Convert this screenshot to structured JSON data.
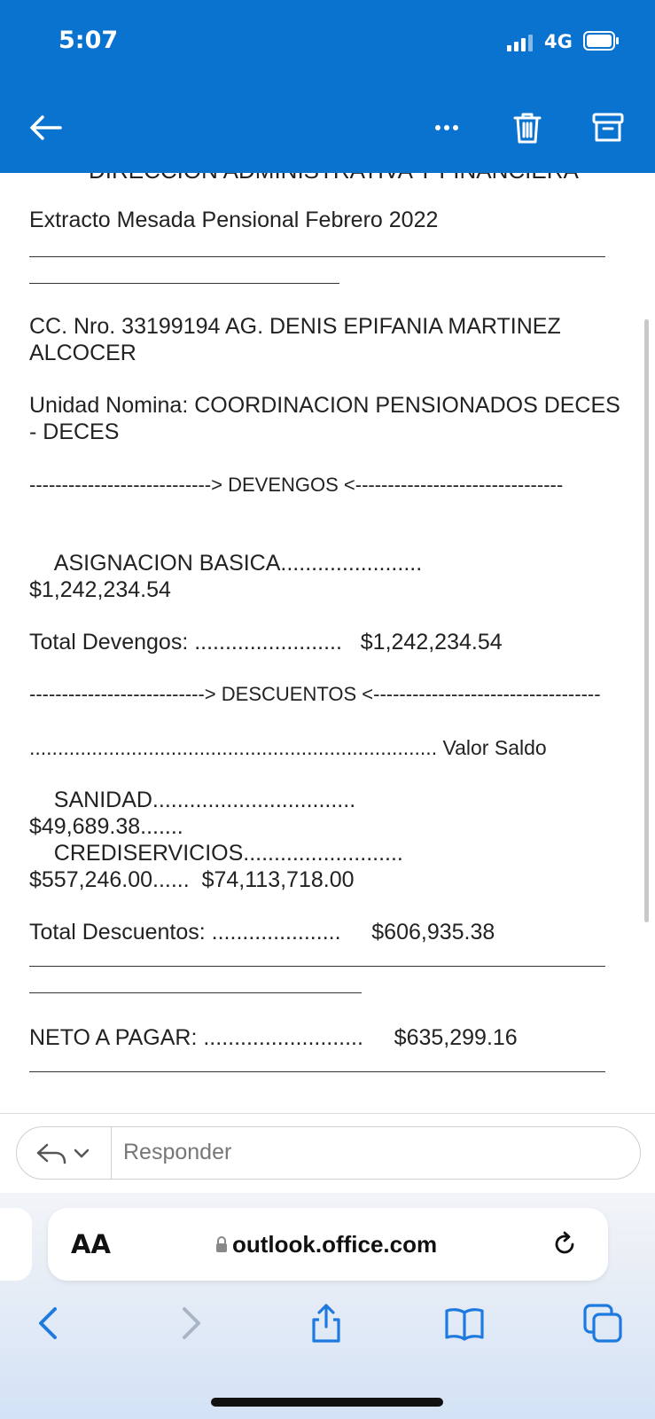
{
  "status_bar": {
    "time": "5:07",
    "network": "4G"
  },
  "email": {
    "cut_header": "DIRECCION ADMINISTRATIVA Y FINANCIERA",
    "subject_line": "Extracto Mesada Pensional Febrero 2022",
    "cc_line": "CC. Nro. 33199194 AG. DENIS EPIFANIA MARTINEZ ALCOCER",
    "unidad_line": "Unidad Nomina: COORDINACION PENSIONADOS DECES - DECES",
    "devengos_header": "----------------------------> DEVENGOS <--------------------------------",
    "devengos_item": "    ASIGNACION BASICA.......................\n$1,242,234.54",
    "total_devengos": "Total Devengos: ........................   $1,242,234.54",
    "descuentos_header": "---------------------------> DESCUENTOS <-----------------------------------",
    "valor_saldo_line": "........................................................................ Valor Saldo",
    "descuentos_items": "    SANIDAD.................................\n$49,689.38.......\n    CREDISERVICIOS..........................\n$557,246.00......  $74,113,718.00",
    "total_descuentos": "Total Descuentos: .....................     $606,935.38",
    "neto_pagar": "NETO A PAGAR: ..........................     $635,299.16"
  },
  "reply": {
    "placeholder": "Responder"
  },
  "browser": {
    "aa_label": "AA",
    "url": "outlook.office.com"
  },
  "colors": {
    "header_blue": "#0a72cf",
    "safari_blue": "#1f7ae0"
  }
}
